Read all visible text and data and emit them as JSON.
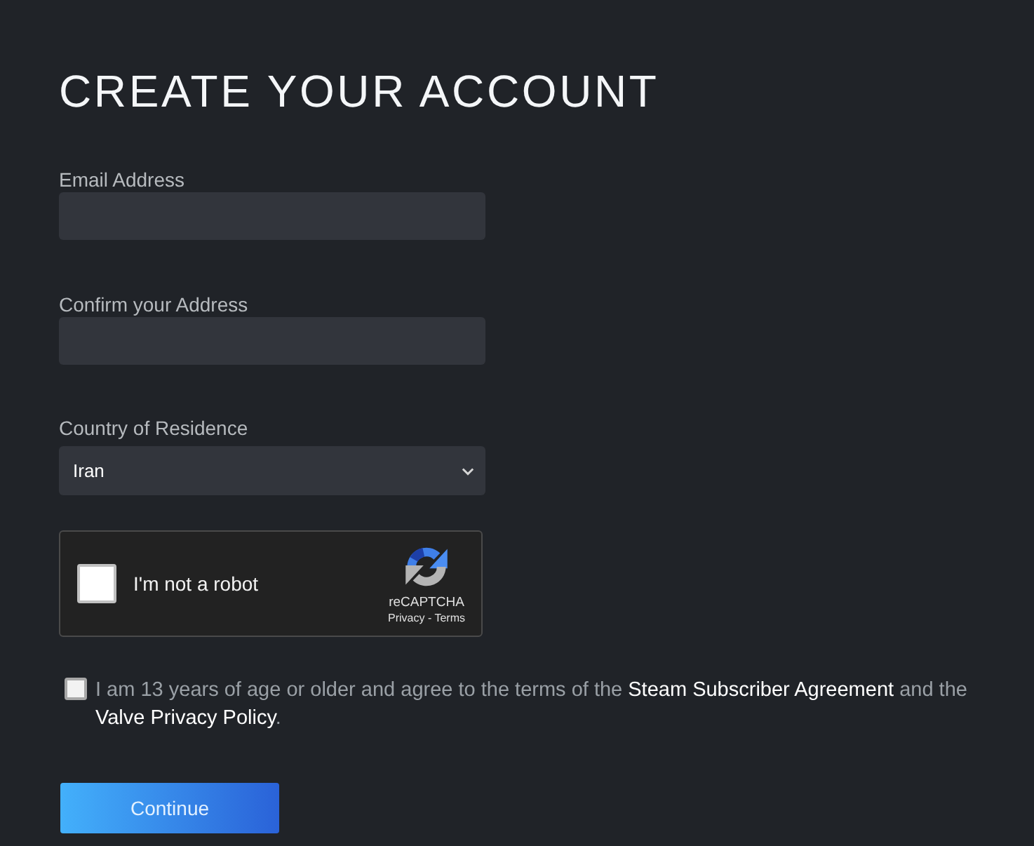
{
  "page": {
    "title": "CREATE YOUR ACCOUNT"
  },
  "fields": [
    {
      "kind": "text",
      "label": "Email Address"
    },
    {
      "kind": "text",
      "label": "Confirm your Address"
    },
    {
      "kind": "select",
      "label": "Country of Residence",
      "value": "Iran"
    }
  ],
  "captcha": {
    "checked": false,
    "label": "I'm not a robot",
    "brand": "reCAPTCHA",
    "footer_links": "Privacy - Terms"
  },
  "agreement": {
    "checked": false,
    "parts": [
      {
        "kind": "text",
        "text": "I am 13 years of age or older and agree to the terms of the "
      },
      {
        "kind": "link",
        "text": "Steam Subscriber Agreement"
      },
      {
        "kind": "text",
        "text": " and the "
      },
      {
        "kind": "link",
        "text": "Valve Privacy Policy"
      },
      {
        "kind": "text",
        "text": "."
      }
    ]
  },
  "button": {
    "label": "Continue"
  }
}
